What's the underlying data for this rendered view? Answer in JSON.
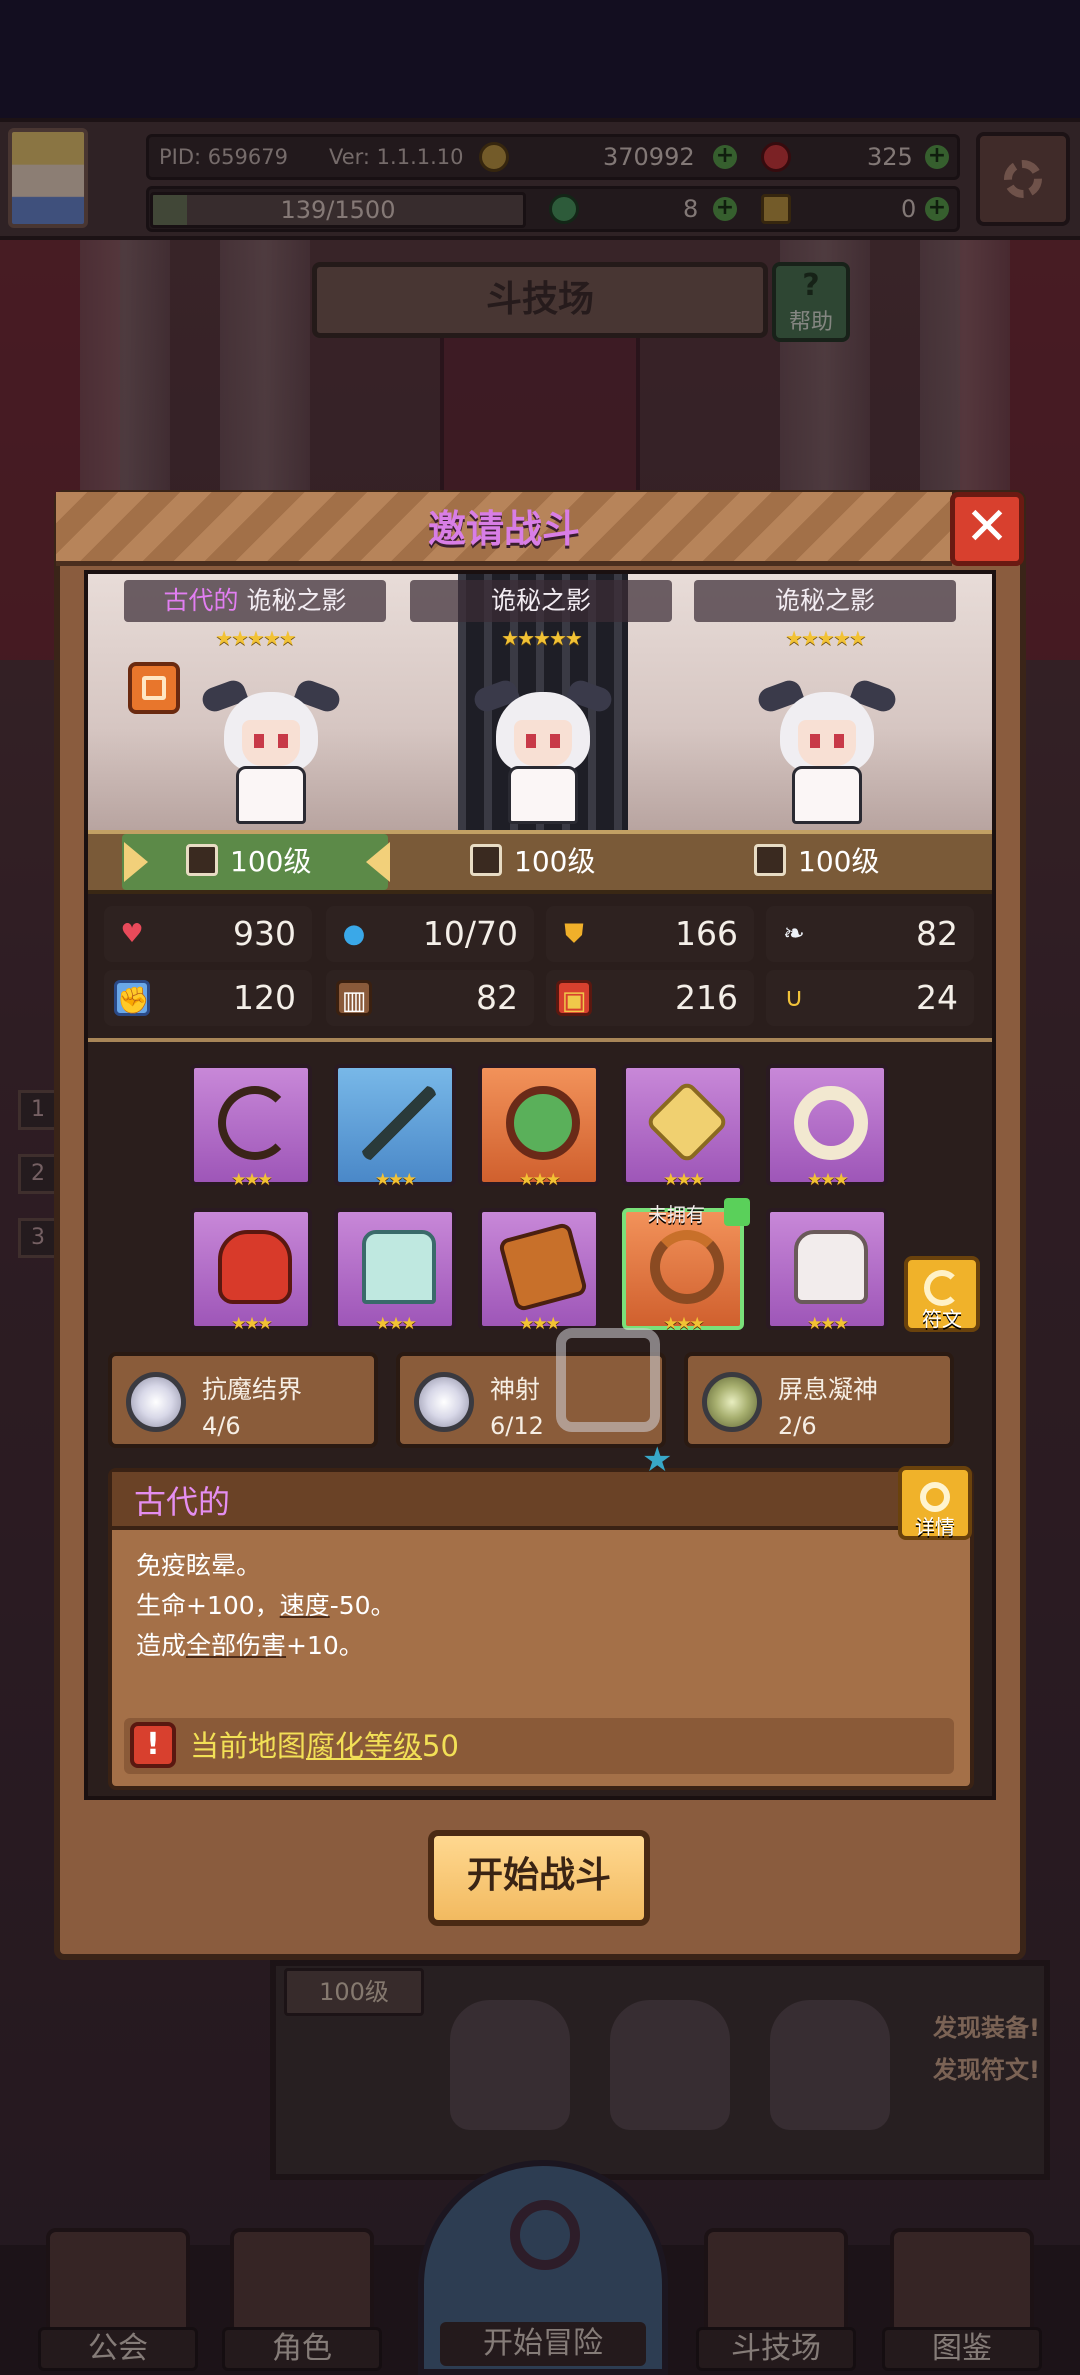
{
  "hud": {
    "pid": "PID: 659679",
    "version": "Ver: 1.1.1.10",
    "gold": "370992",
    "gems": "325",
    "exp": "139/1500",
    "exp_fraction": 0.0927,
    "clover": "8",
    "keys": "0"
  },
  "arena": {
    "title": "斗技场",
    "help_label": "帮助"
  },
  "dialog": {
    "title": "邀请战斗",
    "close": "✕",
    "enemies": [
      {
        "prefix": "古代的",
        "name": "诡秘之影",
        "stars": "★★★★★"
      },
      {
        "prefix": "",
        "name": "诡秘之影",
        "stars": "★★★★★"
      },
      {
        "prefix": "",
        "name": "诡秘之影",
        "stars": "★★★★★"
      }
    ],
    "levels": [
      "100级",
      "100级",
      "100级"
    ],
    "stats": [
      {
        "icon": "heart-icon",
        "value": "930"
      },
      {
        "icon": "mana-drop-icon",
        "value": "10/70"
      },
      {
        "icon": "shield-icon",
        "value": "166"
      },
      {
        "icon": "wing-icon",
        "value": "82"
      },
      {
        "icon": "fist-icon",
        "value": "120"
      },
      {
        "icon": "book-icon",
        "value": "82"
      },
      {
        "icon": "armor-icon",
        "value": "216"
      },
      {
        "icon": "horseshoe-icon",
        "value": "24"
      }
    ],
    "equipment": [
      {
        "name": "bow-icon",
        "rarity": "purple",
        "stars": "★★★"
      },
      {
        "name": "arrow-icon",
        "rarity": "blue",
        "stars": "★★★"
      },
      {
        "name": "heart-amulet-icon",
        "rarity": "orange",
        "stars": "★★★"
      },
      {
        "name": "gem-icon",
        "rarity": "purple",
        "stars": "★★★"
      },
      {
        "name": "ring-icon",
        "rarity": "purple",
        "stars": "★★★"
      },
      {
        "name": "monster-hat-icon",
        "rarity": "purple",
        "stars": "★★★"
      },
      {
        "name": "tunic-icon",
        "rarity": "purple",
        "stars": "★★★"
      },
      {
        "name": "pants-icon",
        "rarity": "purple",
        "stars": "★★★"
      },
      {
        "name": "necklace-icon",
        "rarity": "orange",
        "stars": "★★★"
      },
      {
        "name": "boots-icon",
        "rarity": "purple",
        "stars": "★★★"
      }
    ],
    "unowned_label": "未拥有",
    "rune_label": "符文",
    "sets": [
      {
        "name": "抗魔结界",
        "count": "4/6"
      },
      {
        "name": "神射",
        "count": "6/12"
      },
      {
        "name": "屏息凝神",
        "count": "2/6"
      }
    ],
    "modifier": {
      "title": "古代的",
      "detail_label": "详情",
      "line1": "免疫眩晕。",
      "line2_a": "生命+100，",
      "line2_b": "速度",
      "line2_c": "-50。",
      "line3_a": "造成",
      "line3_b": "全部伤害",
      "line3_c": "+10。",
      "corruption_a": "当前地图",
      "corruption_b": "腐化等级",
      "corruption_c": "50"
    },
    "start_button": "开始战斗"
  },
  "background": {
    "level_tag": "100级",
    "found_equipment": "发现装备!",
    "found_rune": "发现符文!"
  },
  "nav": {
    "guild": "公会",
    "character": "角色",
    "adventure": "开始冒险",
    "arena": "斗技场",
    "codex": "图鉴"
  },
  "colors": {
    "title_pink": "#d87ee6",
    "star_gold": "#f2c234",
    "warning_yellow": "#f2e056",
    "close_red": "#d8402e"
  }
}
